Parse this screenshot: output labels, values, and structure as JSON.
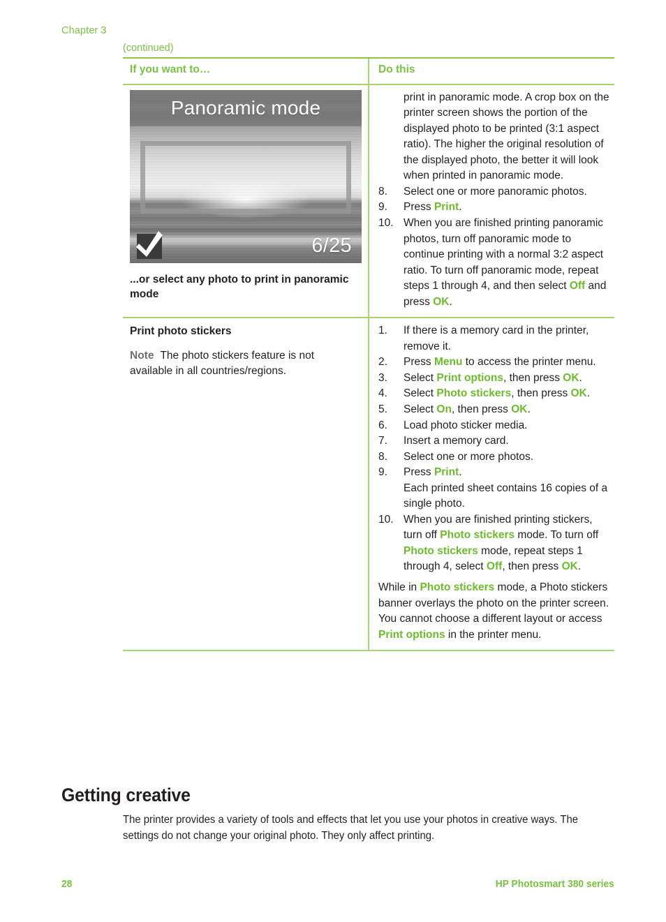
{
  "header": {
    "chapter": "Chapter 3",
    "continued": "(continued)"
  },
  "table": {
    "columns": {
      "left": "If you want to…",
      "right": "Do this"
    },
    "rows": [
      {
        "left": {
          "screen": {
            "banner_text": "Panoramic mode",
            "photo_count": "6/25",
            "selected_icon": "checkmark-icon"
          },
          "caption": "...or select any photo to print in panoramic mode"
        },
        "right": {
          "lead_in": "print in panoramic mode. A crop box on the printer screen shows the portion of the displayed photo to be printed (3:1 aspect ratio). The higher the original resolution of the displayed photo, the better it will look when printed in panoramic mode.",
          "steps": [
            {
              "num": "8.",
              "parts": [
                {
                  "t": "Select one or more panoramic photos."
                }
              ]
            },
            {
              "num": "9.",
              "parts": [
                {
                  "t": "Press "
                },
                {
                  "t": "Print",
                  "hl": true
                },
                {
                  "t": "."
                }
              ]
            },
            {
              "num": "10.",
              "parts": [
                {
                  "t": "When you are finished printing panoramic photos, turn off panoramic mode to continue printing with a normal 3:2 aspect ratio. To turn off panoramic mode, repeat steps 1 through 4, and then select "
                },
                {
                  "t": "Off",
                  "hl": true
                },
                {
                  "t": " and press "
                },
                {
                  "t": "OK",
                  "hl": true
                },
                {
                  "t": "."
                }
              ]
            }
          ]
        }
      },
      {
        "left": {
          "title": "Print photo stickers",
          "note_label": "Note",
          "note_text": "The photo stickers feature is not available in all countries/regions."
        },
        "right": {
          "steps": [
            {
              "num": "1.",
              "parts": [
                {
                  "t": "If there is a memory card in the printer, remove it."
                }
              ]
            },
            {
              "num": "2.",
              "parts": [
                {
                  "t": "Press "
                },
                {
                  "t": "Menu",
                  "hl": true
                },
                {
                  "t": " to access the printer menu."
                }
              ]
            },
            {
              "num": "3.",
              "parts": [
                {
                  "t": "Select "
                },
                {
                  "t": "Print options",
                  "hl": true
                },
                {
                  "t": ", then press "
                },
                {
                  "t": "OK",
                  "hl": true
                },
                {
                  "t": "."
                }
              ]
            },
            {
              "num": "4.",
              "parts": [
                {
                  "t": "Select "
                },
                {
                  "t": "Photo stickers",
                  "hl": true
                },
                {
                  "t": ", then press "
                },
                {
                  "t": "OK",
                  "hl": true
                },
                {
                  "t": "."
                }
              ]
            },
            {
              "num": "5.",
              "parts": [
                {
                  "t": "Select "
                },
                {
                  "t": "On",
                  "hl": true
                },
                {
                  "t": ", then press "
                },
                {
                  "t": "OK",
                  "hl": true
                },
                {
                  "t": "."
                }
              ]
            },
            {
              "num": "6.",
              "parts": [
                {
                  "t": "Load photo sticker media."
                }
              ]
            },
            {
              "num": "7.",
              "parts": [
                {
                  "t": "Insert a memory card."
                }
              ]
            },
            {
              "num": "8.",
              "parts": [
                {
                  "t": "Select one or more photos."
                }
              ]
            },
            {
              "num": "9.",
              "parts": [
                {
                  "t": "Press "
                },
                {
                  "t": "Print",
                  "hl": true
                },
                {
                  "t": ".\nEach printed sheet contains 16 copies of a single photo."
                }
              ]
            },
            {
              "num": "10.",
              "parts": [
                {
                  "t": "When you are finished printing stickers, turn off "
                },
                {
                  "t": "Photo stickers",
                  "hl": true
                },
                {
                  "t": " mode. To turn off "
                },
                {
                  "t": "Photo stickers",
                  "hl": true
                },
                {
                  "t": " mode, repeat steps 1 through 4, select "
                },
                {
                  "t": "Off",
                  "hl": true
                },
                {
                  "t": ", then press "
                },
                {
                  "t": "OK",
                  "hl": true
                },
                {
                  "t": "."
                }
              ]
            }
          ],
          "trailing": [
            {
              "t": "While in "
            },
            {
              "t": "Photo stickers",
              "hl": true
            },
            {
              "t": " mode, a Photo stickers banner overlays the photo on the printer screen. You cannot choose a different layout or access "
            },
            {
              "t": "Print options",
              "hl": true
            },
            {
              "t": " in the printer menu."
            }
          ]
        }
      }
    ]
  },
  "section": {
    "title": "Getting creative",
    "body": "The printer provides a variety of tools and effects that let you use your photos in creative ways. The settings do not change your original photo. They only affect printing."
  },
  "footer": {
    "page_number": "28",
    "product": "HP Photosmart 380 series"
  },
  "colors": {
    "accent_green": "#79c143",
    "highlight_green": "#6cbb2e",
    "rule_green": "#8cc63f",
    "text": "#231f20",
    "note_gray": "#6d6e71"
  }
}
